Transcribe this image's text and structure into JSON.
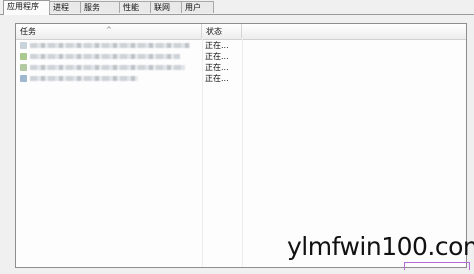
{
  "tabs": [
    {
      "label": "应用程序"
    },
    {
      "label": "进程"
    },
    {
      "label": "服务"
    },
    {
      "label": "性能"
    },
    {
      "label": "联网"
    },
    {
      "label": "用户"
    }
  ],
  "table": {
    "columns": [
      {
        "label": "任务"
      },
      {
        "label": "状态"
      }
    ],
    "rows": [
      {
        "status": "正在..."
      },
      {
        "status": "正在..."
      },
      {
        "status": "正在..."
      },
      {
        "status": "正在..."
      }
    ]
  },
  "watermark": "ylmfwin100.com"
}
